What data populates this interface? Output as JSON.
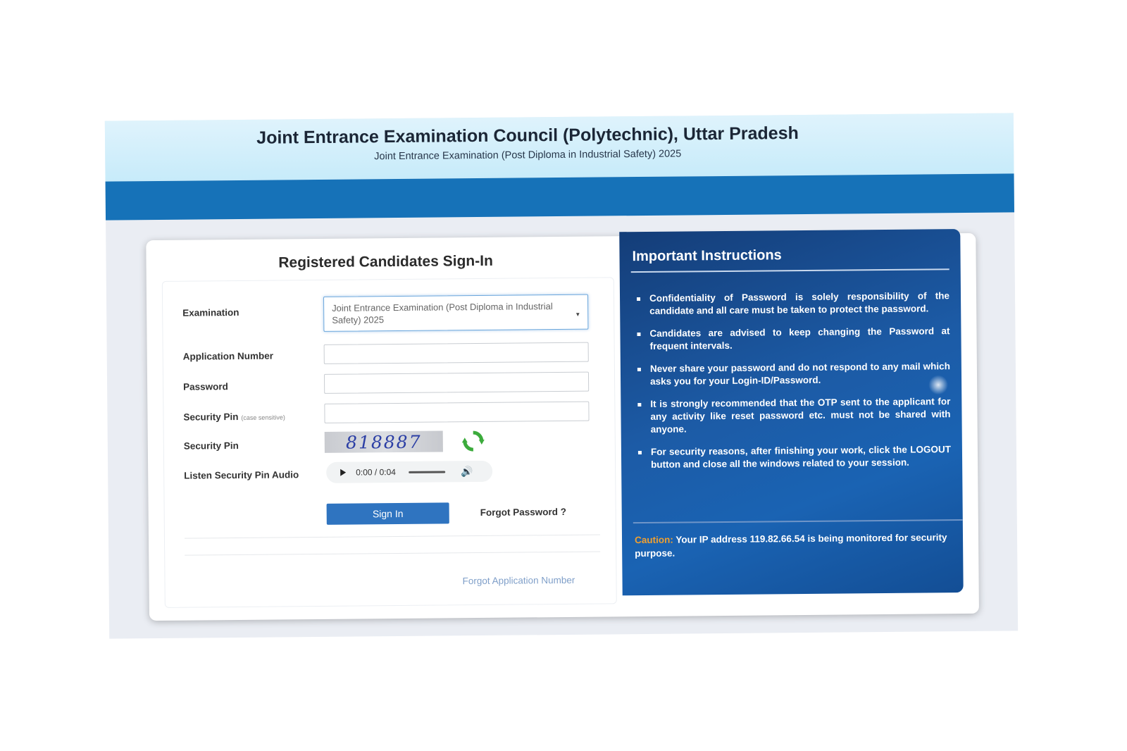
{
  "header": {
    "title": "Joint Entrance Examination Council (Polytechnic), Uttar Pradesh",
    "subtitle": "Joint Entrance Examination (Post Diploma in Industrial Safety) 2025"
  },
  "signin": {
    "title": "Registered Candidates Sign-In",
    "examination_label": "Examination",
    "examination_value": "Joint Entrance Examination (Post Diploma in Industrial Safety) 2025",
    "application_number_label": "Application Number",
    "application_number_value": "",
    "password_label": "Password",
    "password_value": "",
    "security_pin_input_label": "Security Pin",
    "security_pin_case_note": "(case sensitive)",
    "security_pin_input_value": "",
    "security_pin_label": "Security Pin",
    "captcha_text": "818887",
    "audio_label": "Listen Security Pin Audio",
    "audio_time": "0:00 / 0:04",
    "signin_button": "Sign In",
    "forgot_password": "Forgot Password ?",
    "forgot_application_number": "Forgot Application Number"
  },
  "instructions": {
    "title": "Important Instructions",
    "items": [
      "Confidentiality of Password is solely responsibility of the candidate and all care must be taken to protect the password.",
      "Candidates are advised to keep changing the Password at frequent intervals.",
      "Never share your password and do not respond to any mail which asks you for your Login-ID/Password.",
      "It is strongly recommended that the OTP sent to the applicant for any activity like reset password etc. must not be shared with anyone.",
      "For security reasons, after finishing your work, click the LOGOUT button and close all the windows related to your session."
    ],
    "caution_label": "Caution:",
    "caution_text": "Your IP address 119.82.66.54 is being monitored for security purpose."
  },
  "colors": {
    "nav_bar": "#1672b8",
    "instructions_bg": "#1c5ba6",
    "signin_button": "#2f74c0",
    "caution_label": "#f0a030",
    "captcha_text": "#2c3fa5"
  },
  "icons": {
    "refresh": "refresh-icon",
    "play": "play-icon",
    "volume": "volume-icon",
    "dropdown": "chevron-down-icon"
  }
}
